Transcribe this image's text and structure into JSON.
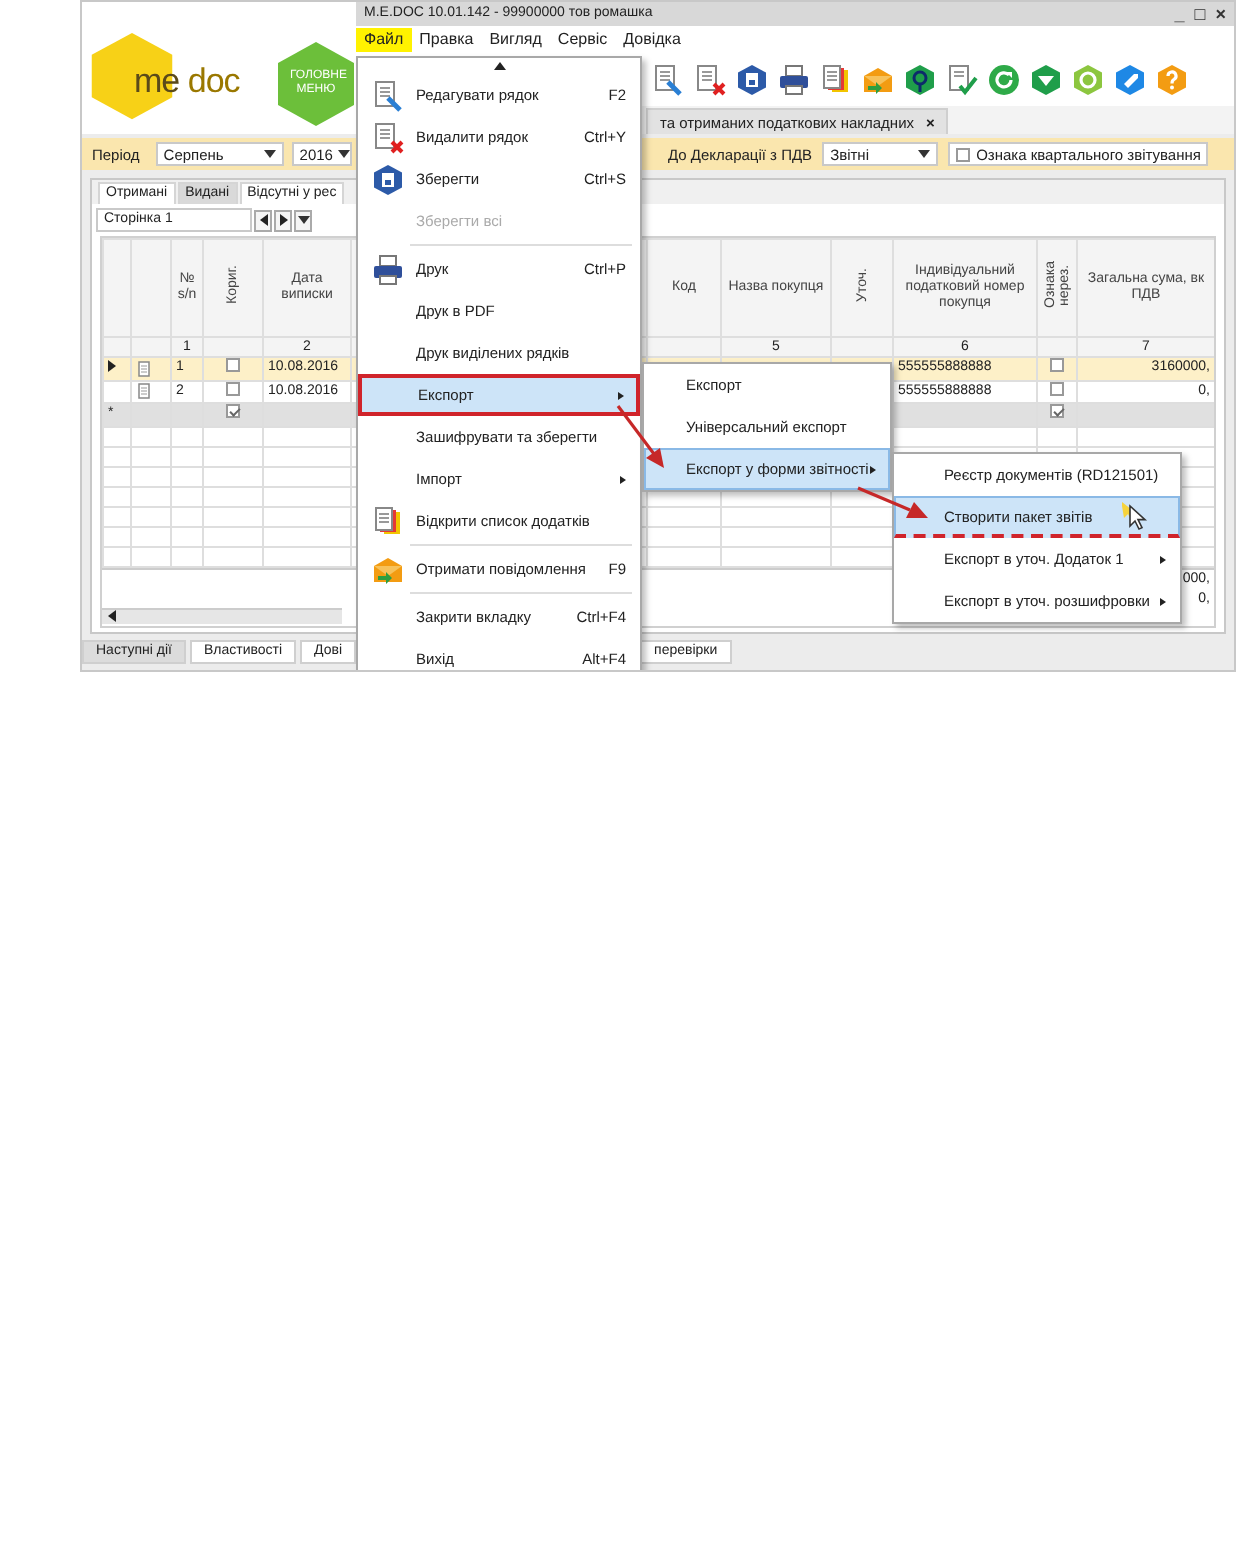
{
  "window": {
    "title": "M.E.DOC 10.01.142 - 99900000 тов ромашка",
    "controls": [
      "_",
      "□",
      "×"
    ]
  },
  "logo": {
    "brand_1": "me",
    "brand_2": "doc"
  },
  "main_menu_button": {
    "label": "ГОЛОВНЕ МЕНЮ"
  },
  "menu_bar": [
    {
      "label": "Файл",
      "selected": true
    },
    {
      "label": "Правка",
      "selected": false
    },
    {
      "label": "Вигляд",
      "selected": false
    },
    {
      "label": "Сервіс",
      "selected": false
    },
    {
      "label": "Довідка",
      "selected": false
    }
  ],
  "document_tab": {
    "label": "та отриманих податкових накладних",
    "close": "×"
  },
  "filter_bar": {
    "period_label": "Період",
    "month": "Серпень",
    "year": "2016",
    "declaration_label": "До Декларації з ПДВ",
    "declaration_type": "Звітні",
    "quarterly": {
      "label": "Ознака квартального звітування",
      "checked": false
    }
  },
  "register_tabs": [
    {
      "label": "Отримані",
      "selected": false
    },
    {
      "label": "Видані",
      "selected": true
    },
    {
      "label": "Відсутні у рес",
      "selected": false
    }
  ],
  "pager": {
    "value": "Сторінка 1"
  },
  "table": {
    "columns": [
      {
        "label": "№ s/n",
        "kind": "text",
        "number": "1"
      },
      {
        "label": "Кориг.",
        "kind": "vertical"
      },
      {
        "label": "Дата виписки",
        "kind": "text",
        "number": "2"
      },
      {
        "label": "Код",
        "kind": "text"
      },
      {
        "label": "Назва покупця",
        "kind": "text",
        "number": "5"
      },
      {
        "label": "Уточ.",
        "kind": "vertical"
      },
      {
        "label": "Індивідуальний податковий номер покупця",
        "kind": "text",
        "number": "6"
      },
      {
        "label": "Ознака нерез.",
        "kind": "vertical"
      },
      {
        "label": "Загальна сума, вк ПДВ",
        "kind": "text",
        "number": "7"
      }
    ],
    "rows": [
      {
        "current": true,
        "selected": true,
        "number": "1",
        "corrective": false,
        "date": "10.08.2016",
        "ipn": "555555888888",
        "nonresident": false,
        "total": "3160000,"
      },
      {
        "current": false,
        "selected": false,
        "number": "2",
        "corrective": false,
        "date": "10.08.2016",
        "ipn": "555555888888",
        "nonresident": false,
        "total": "0,"
      }
    ],
    "new_row": {
      "marker": "*",
      "corrective": true,
      "nonresident": true
    },
    "totals": [
      "000,",
      "0,"
    ]
  },
  "bottom_tabs": [
    {
      "label": "Наступні дії",
      "selected": true
    },
    {
      "label": "Властивості",
      "selected": false
    },
    {
      "label": "Дові",
      "selected": false
    },
    {
      "label": "перевірки",
      "selected": false
    }
  ],
  "file_menu": [
    {
      "kind": "item",
      "label": "Редагувати рядок",
      "shortcut": "F2",
      "disabled": false,
      "selected": false,
      "submenu": false,
      "outlined": false
    },
    {
      "kind": "item",
      "label": "Видалити рядок",
      "shortcut": "Ctrl+Y",
      "disabled": false,
      "selected": false,
      "submenu": false,
      "outlined": false
    },
    {
      "kind": "item",
      "label": "Зберегти",
      "shortcut": "Ctrl+S",
      "disabled": false,
      "selected": false,
      "submenu": false,
      "outlined": false
    },
    {
      "kind": "item",
      "label": "Зберегти всі",
      "disabled": true,
      "selected": false,
      "submenu": false,
      "outlined": false
    },
    {
      "kind": "separator"
    },
    {
      "kind": "item",
      "label": "Друк",
      "shortcut": "Ctrl+P",
      "disabled": false,
      "selected": false,
      "submenu": false,
      "outlined": false
    },
    {
      "kind": "item",
      "label": "Друк в PDF",
      "disabled": false,
      "selected": false,
      "submenu": false,
      "outlined": false
    },
    {
      "kind": "item",
      "label": "Друк виділених рядків",
      "disabled": false,
      "selected": false,
      "submenu": false,
      "outlined": false
    },
    {
      "kind": "item",
      "label": "Експорт",
      "disabled": false,
      "selected": true,
      "submenu": true,
      "outlined": true
    },
    {
      "kind": "item",
      "label": "Зашифрувати та зберегти",
      "disabled": false,
      "selected": false,
      "submenu": false,
      "outlined": false
    },
    {
      "kind": "item",
      "label": "Імпорт",
      "disabled": false,
      "selected": false,
      "submenu": true,
      "outlined": false
    },
    {
      "kind": "item",
      "label": "Відкрити список додатків",
      "disabled": false,
      "selected": false,
      "submenu": false,
      "outlined": false
    },
    {
      "kind": "separator"
    },
    {
      "kind": "item",
      "label": "Отримати повідомлення",
      "shortcut": "F9",
      "disabled": false,
      "selected": false,
      "submenu": false,
      "outlined": false
    },
    {
      "kind": "separator"
    },
    {
      "kind": "item",
      "label": "Закрити вкладку",
      "shortcut": "Ctrl+F4",
      "disabled": false,
      "selected": false,
      "submenu": false,
      "outlined": false
    },
    {
      "kind": "item",
      "label": "Вихід",
      "shortcut": "Alt+F4",
      "disabled": false,
      "selected": false,
      "submenu": false,
      "outlined": false
    }
  ],
  "export_submenu": [
    {
      "label": "Експорт",
      "selected": false,
      "submenu": false
    },
    {
      "label": "Універсальний експорт",
      "selected": false,
      "submenu": false
    },
    {
      "label": "Експорт у форми звітності",
      "selected": true,
      "submenu": true
    }
  ],
  "report_submenu": [
    {
      "label": "Реєстр документів (RD121501)",
      "selected": false,
      "submenu": false,
      "underlined": false
    },
    {
      "label": "Створити пакет звітів",
      "selected": true,
      "submenu": false,
      "underlined": true
    },
    {
      "label": "Експорт в уточ. Додаток 1",
      "selected": false,
      "submenu": true,
      "underlined": false
    },
    {
      "label": "Експорт в уточ. розшифровки",
      "selected": false,
      "submenu": true,
      "underlined": false
    }
  ]
}
